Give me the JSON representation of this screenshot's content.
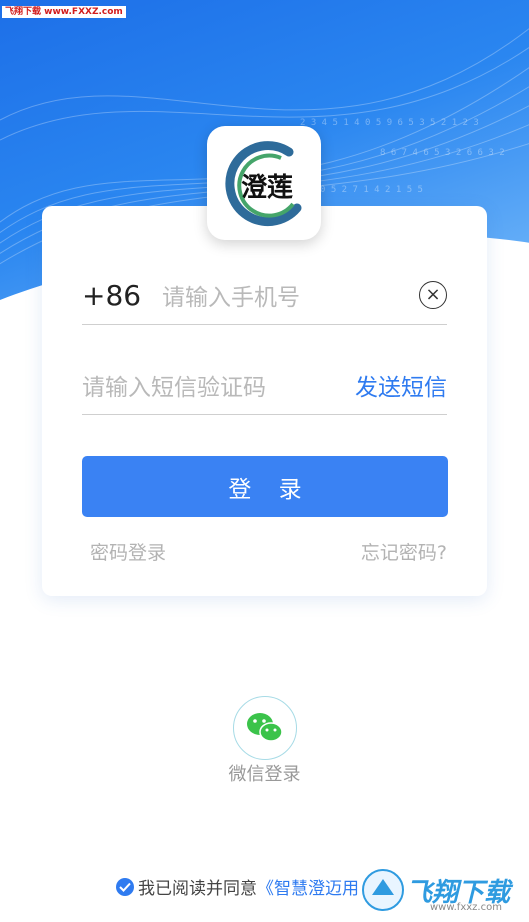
{
  "watermark": {
    "text": "飞翔下载 www.FXXZ.com"
  },
  "logo": {
    "text": "澄莲"
  },
  "form": {
    "country_code": "+86",
    "phone_placeholder": "请输入手机号",
    "code_placeholder": "请输入短信验证码",
    "send_sms": "发送短信",
    "login_label": "登 录",
    "password_login": "密码登录",
    "forgot_password": "忘记密码?"
  },
  "social": {
    "wechat_label": "微信登录"
  },
  "agreement": {
    "prefix": "我已阅读并同意",
    "doc": "《智慧澄迈用"
  },
  "brand": {
    "text": "飞翔下载",
    "url": "www.fxxz.com"
  },
  "colors": {
    "accent": "#2f7bf0",
    "hero": "#1d6fe8",
    "wechat": "#3bc34a"
  }
}
